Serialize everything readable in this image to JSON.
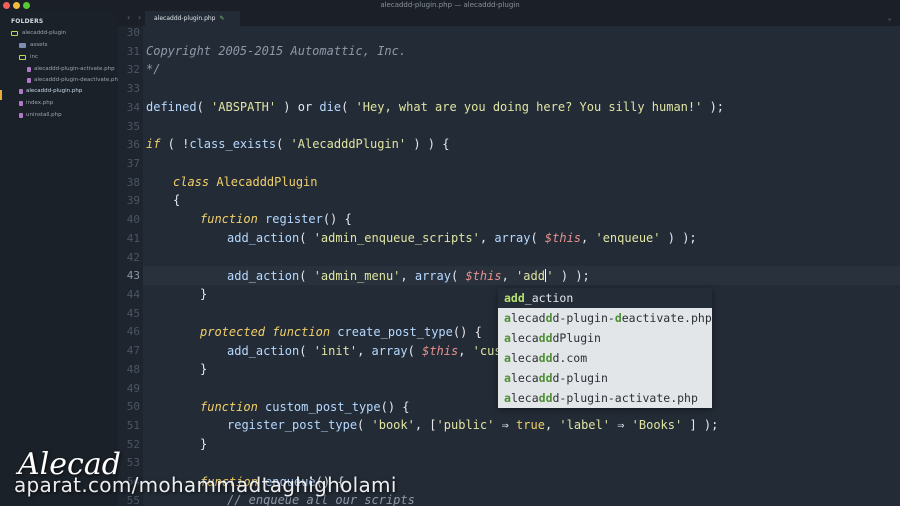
{
  "window": {
    "title": "alecaddd-plugin.php — alecaddd-plugin"
  },
  "sidebar": {
    "header": "FOLDERS",
    "tree": [
      {
        "label": "alecaddd-plugin",
        "type": "folder-open"
      },
      {
        "label": "assets",
        "type": "folder"
      },
      {
        "label": "inc",
        "type": "folder-open"
      },
      {
        "label": "alecaddd-plugin-activate.php",
        "type": "file"
      },
      {
        "label": "alecaddd-plugin-deactivate.php",
        "type": "file"
      },
      {
        "label": "alecaddd-plugin.php",
        "type": "file",
        "active": true
      },
      {
        "label": "index.php",
        "type": "file"
      },
      {
        "label": "uninstall.php",
        "type": "file"
      }
    ]
  },
  "tabs": {
    "back": "‹",
    "forward": "›",
    "active_tab": "alecaddd-plugin.php",
    "edit_mark": "✎",
    "menu": "⌄"
  },
  "editor": {
    "line_numbers": [
      "30",
      "31",
      "32",
      "33",
      "34",
      "35",
      "36",
      "37",
      "38",
      "39",
      "40",
      "41",
      "42",
      "43",
      "44",
      "45",
      "46",
      "47",
      "48",
      "49",
      "50",
      "51",
      "52",
      "53",
      "54",
      "55"
    ],
    "current_line": "43",
    "code": {
      "l30": "Copyright 2005-2015 Automattic, Inc.",
      "l31": "*/",
      "l33_a": "defined",
      "l33_b": "( ",
      "l33_c": "'ABSPATH'",
      "l33_d": " ) or ",
      "l33_e": "die",
      "l33_f": "( ",
      "l33_g": "'Hey, what are you doing here? You silly human!'",
      "l33_h": " );",
      "l35_a": "if",
      "l35_b": " ( !",
      "l35_c": "class_exists",
      "l35_d": "( ",
      "l35_e": "'AlecadddPlugin'",
      "l35_f": " ) ) {",
      "l37_a": "class",
      "l37_b": " AlecadddPlugin",
      "l38": "{",
      "l39_a": "function",
      "l39_b": " register",
      "l39_c": "() {",
      "l40_a": "add_action",
      "l40_b": "( ",
      "l40_c": "'admin_enqueue_scripts'",
      "l40_d": ", ",
      "l40_e": "array",
      "l40_f": "( ",
      "l40_g": "$this",
      "l40_h": ", ",
      "l40_i": "'enqueue'",
      "l40_j": " ) );",
      "l42_a": "add_action",
      "l42_b": "( ",
      "l42_c": "'admin_menu'",
      "l42_d": ", ",
      "l42_e": "array",
      "l42_f": "( ",
      "l42_g": "$this",
      "l42_h": ", ",
      "l42_i": "'add",
      "l42_j": "'",
      "l42_k": " ) );",
      "l43": "}",
      "l45_a": "protected",
      "l45_b": " function",
      "l45_c": " create_post_type",
      "l45_d": "() {",
      "l46_a": "add_action",
      "l46_b": "( ",
      "l46_c": "'init'",
      "l46_d": ", ",
      "l46_e": "array",
      "l46_f": "( ",
      "l46_g": "$this",
      "l46_h": ", ",
      "l46_i": "'custo",
      "l47": "}",
      "l49_a": "function",
      "l49_b": " custom_post_type",
      "l49_c": "() {",
      "l50_a": "register_post_type",
      "l50_b": "( ",
      "l50_c": "'book'",
      "l50_d": ", [",
      "l50_e": "'public'",
      "l50_f": " ⇒ ",
      "l50_g": "true",
      "l50_h": ", ",
      "l50_i": "'label'",
      "l50_j": " ⇒ ",
      "l50_k": "'Books'",
      "l50_l": " ] );",
      "l51": "}",
      "l53_a": "function",
      "l53_b": " enqueue",
      "l53_c": "() {",
      "l54": "// enqueue all our scripts"
    }
  },
  "autocomplete": {
    "items": [
      {
        "match": "add",
        "rest": "_action"
      },
      {
        "a": "a",
        "b": "lecad",
        "c": "d",
        "d": "d-plugin-",
        "e": "d",
        "f": "eactivate.php"
      },
      {
        "a": "a",
        "b": "leca",
        "c": "dd",
        "d": "dPlugin"
      },
      {
        "a": "a",
        "b": "leca",
        "c": "dd",
        "d": "d.com"
      },
      {
        "a": "a",
        "b": "leca",
        "c": "dd",
        "d": "d-plugin"
      },
      {
        "a": "a",
        "b": "leca",
        "c": "dd",
        "d": "d-plugin-activate.php"
      }
    ]
  },
  "watermark": {
    "signature": "Alecad",
    "url": "aparat.com/mohammadtaghigholami"
  }
}
